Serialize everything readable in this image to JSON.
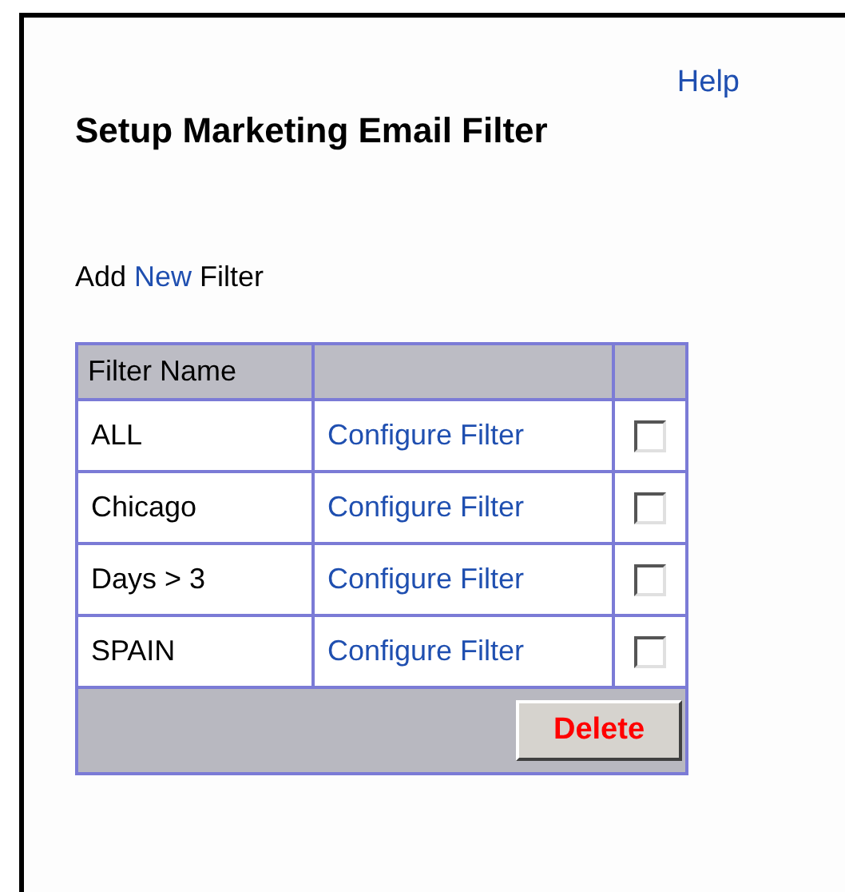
{
  "help_link": "Help",
  "title": "Setup Marketing Email Filter",
  "add_filter": {
    "before": "Add",
    "link": "New",
    "after": "Filter"
  },
  "table": {
    "columns": [
      "Filter Name"
    ],
    "rows": [
      {
        "name": "ALL",
        "action": "Configure Filter",
        "checked": false
      },
      {
        "name": "Chicago",
        "action": "Configure Filter",
        "checked": false
      },
      {
        "name": "Days > 3",
        "action": "Configure Filter",
        "checked": false
      },
      {
        "name": "SPAIN",
        "action": "Configure Filter",
        "checked": false
      }
    ],
    "footer_button": "Delete"
  }
}
